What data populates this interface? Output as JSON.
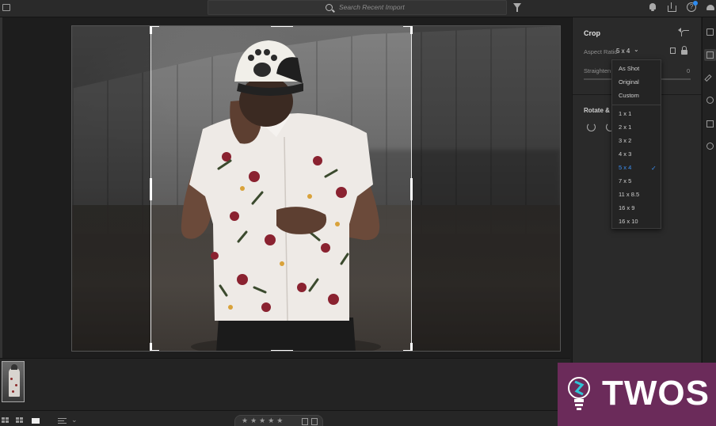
{
  "topbar": {
    "search_placeholder": "Search Recent Import",
    "help_label": "?"
  },
  "panel": {
    "title": "Crop",
    "aspect_label": "Aspect Ratio",
    "aspect_value": "5 x 4",
    "straighten_label": "Straighten",
    "straighten_value": "0",
    "rotate_label": "Rotate & F"
  },
  "dropdown": {
    "options_top": [
      "As Shot",
      "Original",
      "Custom"
    ],
    "options_ratios": [
      "1 x 1",
      "2 x 1",
      "3 x 2",
      "4 x 3",
      "5 x 4",
      "7 x 5",
      "11 x 8.5",
      "16 x 9",
      "16 x 10"
    ],
    "selected": "5 x 4",
    "check": "✓"
  },
  "bottombar": {
    "stars": "★★★★★",
    "sort_chevron": "⌄"
  },
  "watermark": {
    "text": "TWOS"
  },
  "colors": {
    "accent": "#3b8ef0",
    "watermark_bg": "#6b2b5a",
    "panel_bg": "#2a2a2a"
  }
}
